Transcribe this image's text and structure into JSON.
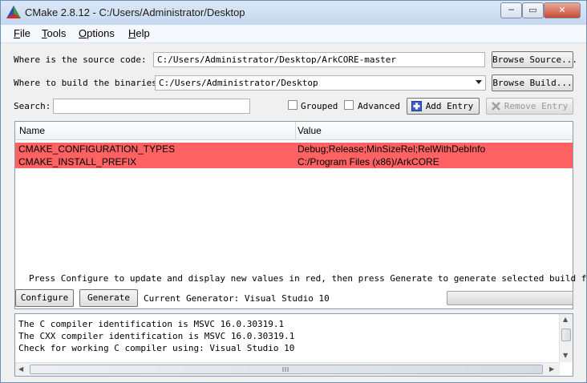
{
  "window": {
    "title": "CMake 2.8.12 - C:/Users/Administrator/Desktop",
    "minimize_label": "─",
    "maximize_label": "▭",
    "close_label": "✕"
  },
  "menu": {
    "items": [
      {
        "accel": "F",
        "rest": "ile"
      },
      {
        "accel": "T",
        "rest": "ools"
      },
      {
        "accel": "O",
        "rest": "ptions"
      },
      {
        "accel": "H",
        "rest": "elp"
      }
    ]
  },
  "source": {
    "label": "Where is the source code:",
    "value": "C:/Users/Administrator/Desktop/ArkCORE-master",
    "browse_label": "Browse Source..."
  },
  "build": {
    "label": "Where to build the binaries:",
    "value": "C:/Users/Administrator/Desktop",
    "browse_label": "Browse Build..."
  },
  "search": {
    "label": "Search:",
    "value": ""
  },
  "options": {
    "grouped_label": "Grouped",
    "advanced_label": "Advanced",
    "add_entry_label": "Add Entry",
    "remove_entry_label": "Remove Entry"
  },
  "table": {
    "headers": [
      "Name",
      "Value"
    ],
    "rows": [
      {
        "name": "CMAKE_CONFIGURATION_TYPES",
        "value": "Debug;Release;MinSizeRel;RelWithDebInfo"
      },
      {
        "name": "CMAKE_INSTALL_PREFIX",
        "value": "C:/Program Files (x86)/ArkCORE"
      }
    ],
    "row_color": "#ff6262"
  },
  "hint": "Press Configure to update and display new values in red, then press Generate to generate selected build files.",
  "actions": {
    "configure_label": "Configure",
    "generate_label": "Generate",
    "generator_text": "Current Generator: Visual Studio 10"
  },
  "output": {
    "lines": [
      "The C compiler identification is MSVC 16.0.30319.1",
      "The CXX compiler identification is MSVC 16.0.30319.1",
      "Check for working C compiler using: Visual Studio 10"
    ]
  },
  "icons": {
    "app": "cmake-triangle-icon",
    "add": "plus-icon",
    "remove": "x-icon"
  }
}
